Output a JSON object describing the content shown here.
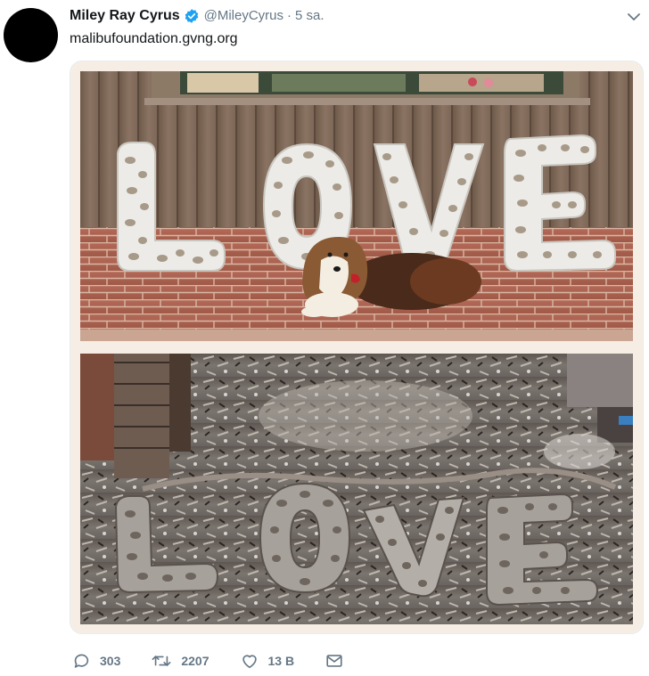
{
  "tweet": {
    "display_name": "Miley Ray Cyrus",
    "handle": "@MileyCyrus",
    "separator": "·",
    "time": "5 sa.",
    "text": "malibufoundation.gvng.org"
  },
  "media": {
    "top_photo_letters": [
      "L",
      "O",
      "V",
      "E"
    ],
    "bottom_photo_letters": [
      "L",
      "O",
      "V",
      "E"
    ]
  },
  "actions": {
    "reply_count": "303",
    "retweet_count": "2207",
    "like_count": "13 B"
  },
  "icons": {
    "verified": "verified-badge-icon",
    "caret": "chevron-down-icon",
    "reply": "reply-icon",
    "retweet": "retweet-icon",
    "like": "heart-icon",
    "message": "envelope-icon"
  },
  "colors": {
    "verified_blue": "#1da1f2",
    "secondary_text": "#657786",
    "primary_text": "#14171a"
  }
}
